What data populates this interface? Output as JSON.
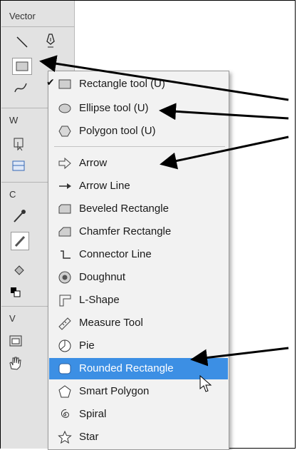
{
  "panel": {
    "title": "Vector",
    "truncated_labels": [
      "W",
      "C",
      "V"
    ]
  },
  "menu": {
    "items": [
      {
        "label": "Rectangle tool (U)",
        "icon": "rectangle-icon",
        "checked": true
      },
      {
        "label": "Ellipse tool (U)",
        "icon": "ellipse-icon"
      },
      {
        "label": "Polygon tool (U)",
        "icon": "polygon-icon"
      },
      {
        "label": "Arrow",
        "icon": "arrow-icon"
      },
      {
        "label": "Arrow Line",
        "icon": "arrow-line-icon"
      },
      {
        "label": "Beveled Rectangle",
        "icon": "beveled-rectangle-icon"
      },
      {
        "label": "Chamfer Rectangle",
        "icon": "chamfer-rectangle-icon"
      },
      {
        "label": "Connector Line",
        "icon": "connector-line-icon"
      },
      {
        "label": "Doughnut",
        "icon": "doughnut-icon"
      },
      {
        "label": "L-Shape",
        "icon": "l-shape-icon"
      },
      {
        "label": "Measure Tool",
        "icon": "measure-tool-icon"
      },
      {
        "label": "Pie",
        "icon": "pie-icon"
      },
      {
        "label": "Rounded Rectangle",
        "icon": "rounded-rectangle-icon",
        "highlighted": true
      },
      {
        "label": "Smart Polygon",
        "icon": "smart-polygon-icon"
      },
      {
        "label": "Spiral",
        "icon": "spiral-icon"
      },
      {
        "label": "Star",
        "icon": "star-icon"
      }
    ]
  },
  "check_mark": "✔",
  "colors": {
    "highlight": "#3c8fe4",
    "menu_bg": "#f2f2f2",
    "panel_bg": "#e2e2e2"
  }
}
